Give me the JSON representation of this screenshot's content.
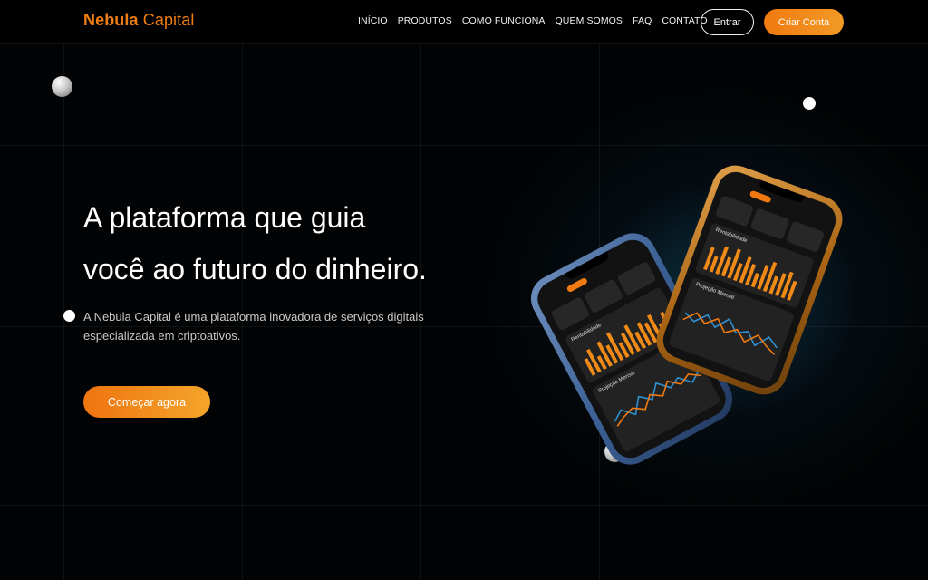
{
  "brand": {
    "name_part1": "Nebula",
    "name_part2": "Capital",
    "accent": "#f07d12"
  },
  "nav": {
    "items": [
      "INÍCIO",
      "PRODUTOS",
      "COMO FUNCIONA",
      "QUEM SOMOS",
      "FAQ",
      "CONTATO"
    ],
    "login_label": "Entrar",
    "signup_label": "Criar Conta"
  },
  "hero": {
    "title_line1": "A plataforma que guia",
    "title_line2": "você ao futuro do dinheiro.",
    "subtitle_line1": "A Nebula Capital é uma plataforma inovadora de serviços digitais",
    "subtitle_line2": "especializada em criptoativos.",
    "cta_label": "Começar agora"
  },
  "phones": {
    "panel_title_1": "Rentabilidade",
    "panel_title_2": "Projeção Mensal"
  }
}
